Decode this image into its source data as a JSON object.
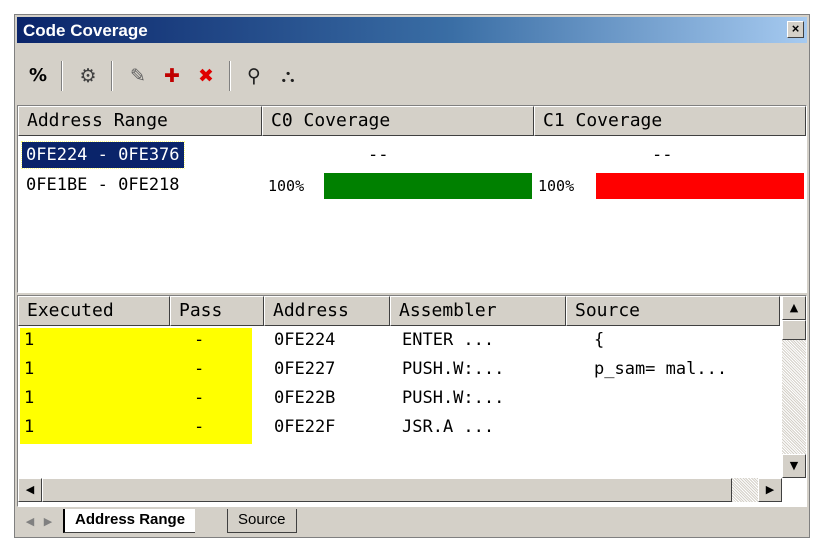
{
  "window": {
    "title": "Code Coverage",
    "close_glyph": "×"
  },
  "toolbar": {
    "items": [
      {
        "name": "percent-icon",
        "glyph": "%"
      },
      {
        "name": "coverage-refresh-icon",
        "glyph": "⚙"
      },
      {
        "name": "edit-range-icon",
        "glyph": "✎"
      },
      {
        "name": "add-range-icon",
        "glyph": "✚"
      },
      {
        "name": "delete-range-icon",
        "glyph": "✖"
      },
      {
        "name": "open-source-icon",
        "glyph": "⚲"
      },
      {
        "name": "search-icon",
        "glyph": "⛬"
      }
    ]
  },
  "top_table": {
    "headers": [
      "Address Range",
      "C0 Coverage",
      "C1 Coverage"
    ],
    "rows": [
      {
        "range": "0FE224 - 0FE376",
        "c0": "--",
        "c1": "--",
        "selected": true
      },
      {
        "range": "0FE1BE - 0FE218",
        "c0": "100%",
        "c1": "100%",
        "c0_fill": 1.0,
        "c1_fill": 1.0
      }
    ],
    "colors": {
      "c0_bar": "#008000",
      "c1_bar": "#ff0000",
      "selection": "#0a246a"
    }
  },
  "bottom_table": {
    "headers": [
      "Executed",
      "Pass",
      "Address",
      "Assembler",
      "Source"
    ],
    "rows": [
      {
        "executed": "1",
        "pass": "-",
        "address": "0FE224",
        "asm": "ENTER  ...",
        "source": "{"
      },
      {
        "executed": "1",
        "pass": "-",
        "address": "0FE227",
        "asm": "PUSH.W:...",
        "source": "p_sam= mal..."
      },
      {
        "executed": "1",
        "pass": "-",
        "address": "0FE22B",
        "asm": "PUSH.W:...",
        "source": ""
      },
      {
        "executed": "1",
        "pass": "-",
        "address": "0FE22F",
        "asm": "JSR.A  ...",
        "source": ""
      }
    ],
    "highlight": "#ffff00"
  },
  "scroll": {
    "up": "▲",
    "down": "▼",
    "left": "◀",
    "right": "▶"
  },
  "tabs": {
    "items": [
      "Address Range",
      "Source"
    ],
    "active": "Address Range",
    "nav": [
      "◀",
      "▶"
    ]
  }
}
